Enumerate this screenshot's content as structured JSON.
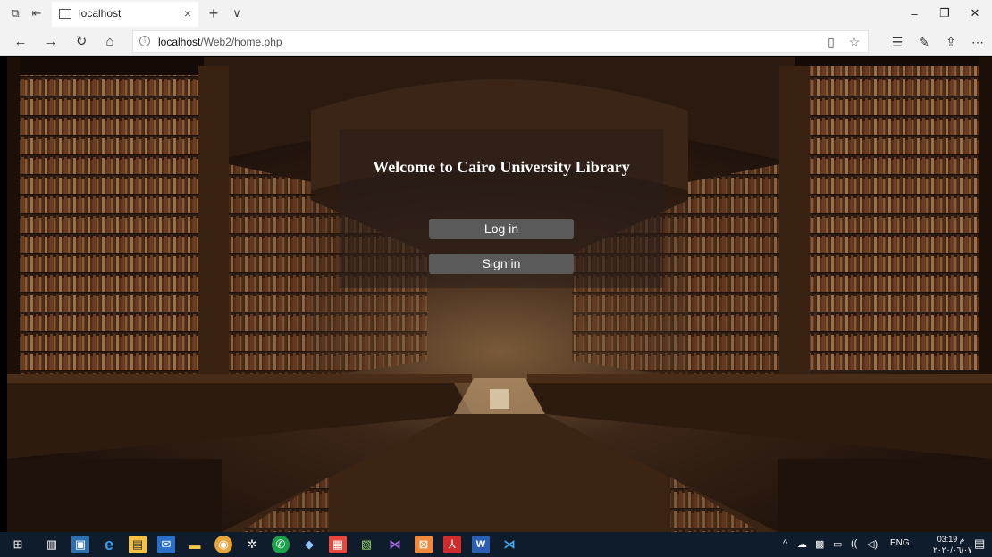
{
  "browser": {
    "tab_title": "localhost",
    "tab_close": "×",
    "new_tab": "+",
    "tab_menu": "∨",
    "url_host": "localhost",
    "url_path": "/Web2/home.php",
    "window_minimize": "–",
    "window_maximize": "❐",
    "window_close": "✕"
  },
  "page": {
    "welcome_title": "Welcome to Cairo University Library",
    "login_label": "Log in",
    "signin_label": "Sign in"
  },
  "taskbar": {
    "lang": "ENG",
    "time": "03:19 م",
    "date": "٢٠٢٠/٠٦/٠٧"
  },
  "colors": {
    "tab_strip": "#f2f2f2",
    "panel": "rgba(40,30,25,0.55)",
    "button": "#5a5a5a",
    "taskbar": "#0f1c2c"
  }
}
